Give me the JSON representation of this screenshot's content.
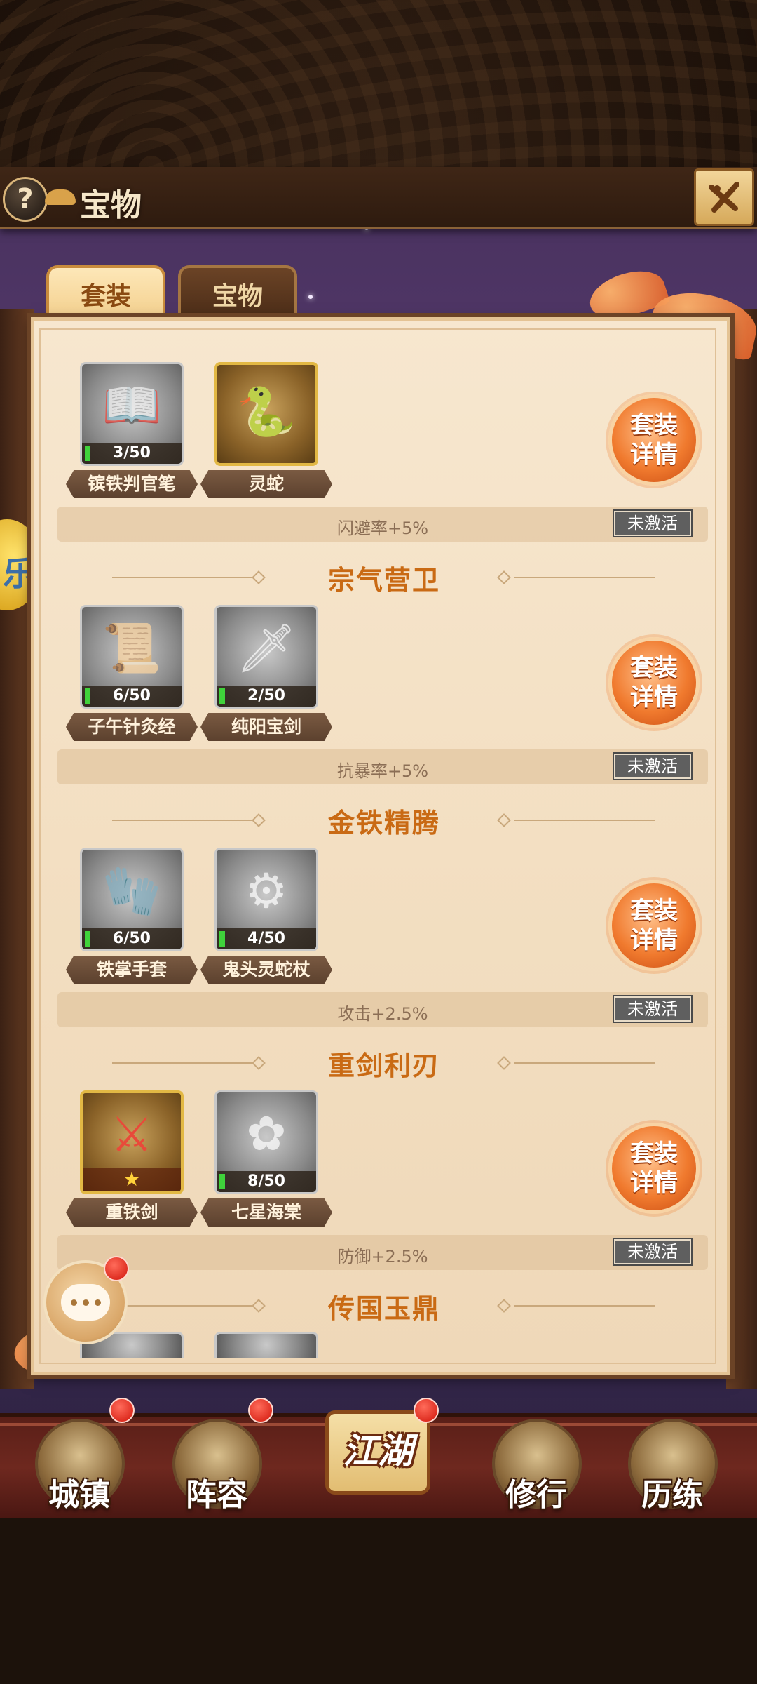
{
  "header": {
    "title": "宝物",
    "help_icon": "?",
    "close_icon": "close-icon"
  },
  "tabs": [
    {
      "label": "套装",
      "active": true
    },
    {
      "label": "宝物",
      "active": false
    }
  ],
  "side_badge_char": "乐",
  "sets": [
    {
      "title": "",
      "items": [
        {
          "name": "镔铁判官笔",
          "count": "3/50",
          "rarity": "silver",
          "icon": "book-icon"
        },
        {
          "name": "灵蛇",
          "count": "",
          "rarity": "gold",
          "icon": "snake-icon"
        }
      ],
      "detail_button": [
        "套装",
        "详情"
      ],
      "bonus": "闪避率+5%",
      "status": "未激活"
    },
    {
      "title": "宗气营卫",
      "items": [
        {
          "name": "子午针灸经",
          "count": "6/50",
          "rarity": "silver",
          "icon": "scroll-book-icon"
        },
        {
          "name": "纯阳宝剑",
          "count": "2/50",
          "rarity": "silver",
          "icon": "sword-icon"
        }
      ],
      "detail_button": [
        "套装",
        "详情"
      ],
      "bonus": "抗暴率+5%",
      "status": "未激活"
    },
    {
      "title": "金铁精腾",
      "items": [
        {
          "name": "铁掌手套",
          "count": "6/50",
          "rarity": "silver",
          "icon": "gauntlet-icon"
        },
        {
          "name": "鬼头灵蛇杖",
          "count": "4/50",
          "rarity": "silver",
          "icon": "staff-icon"
        }
      ],
      "detail_button": [
        "套装",
        "详情"
      ],
      "bonus": "攻击+2.5%",
      "status": "未激活"
    },
    {
      "title": "重剑利刃",
      "items": [
        {
          "name": "重铁剑",
          "count": "",
          "stars": "★",
          "rarity": "gold",
          "icon": "heavy-sword-icon"
        },
        {
          "name": "七星海棠",
          "count": "8/50",
          "rarity": "silver",
          "icon": "flower-icon"
        }
      ],
      "detail_button": [
        "套装",
        "详情"
      ],
      "bonus": "防御+2.5%",
      "status": "未激活"
    },
    {
      "title": "传国玉鼎",
      "items": [],
      "detail_button": [],
      "bonus": "",
      "status": ""
    }
  ],
  "nav": [
    {
      "label": "城镇",
      "icon": "town-icon",
      "badge": true
    },
    {
      "label": "阵容",
      "icon": "lineup-icon",
      "badge": true
    },
    {
      "label": "江湖",
      "icon": "jianghu-scroll-icon",
      "badge": true,
      "center": true
    },
    {
      "label": "修行",
      "icon": "cultivate-icon",
      "badge": false
    },
    {
      "label": "历练",
      "icon": "training-icon",
      "badge": false
    }
  ],
  "colors": {
    "accent_orange": "#c96a14",
    "panel_bg": "#f7e7cf",
    "progress_green": "#3fd23b",
    "badge_red": "#d1150a"
  }
}
